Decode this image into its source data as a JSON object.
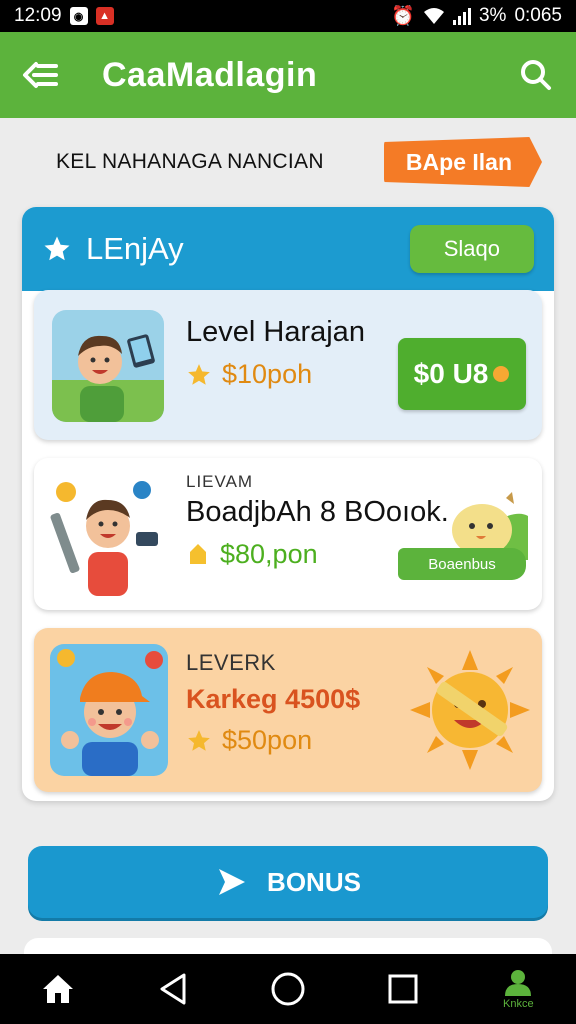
{
  "status_bar": {
    "time_left": "12:09",
    "battery": "3%",
    "time_right": "0:065"
  },
  "app_bar": {
    "title": "CaaMadlagin",
    "back_icon": "back-arrow-icon",
    "search_icon": "search-icon"
  },
  "subheader": {
    "title": "KEL NAHANAGA NANCIAN",
    "button_label": "BApe Ilan"
  },
  "panel": {
    "header_title": "LEnjAy",
    "header_button": "Slaqo"
  },
  "cards": [
    {
      "title": "Level Harajan",
      "price": "$10poh",
      "button": "$0 U8"
    },
    {
      "label": "LIEVAM",
      "title": "BoadjbAh 8 BOoıok.",
      "price": "$80,pon",
      "tag": "Boaenbus"
    },
    {
      "label": "LEVERK",
      "subtitle": "Karkeg 4500$",
      "price": "$50pon"
    }
  ],
  "bonus_button": {
    "label": "BONUS"
  },
  "nav": {
    "home_label": "",
    "profile_label": "Knkce"
  },
  "colors": {
    "brand_green": "#5cb33c",
    "brand_blue": "#1c9bd0",
    "accent_orange": "#f47b26"
  }
}
